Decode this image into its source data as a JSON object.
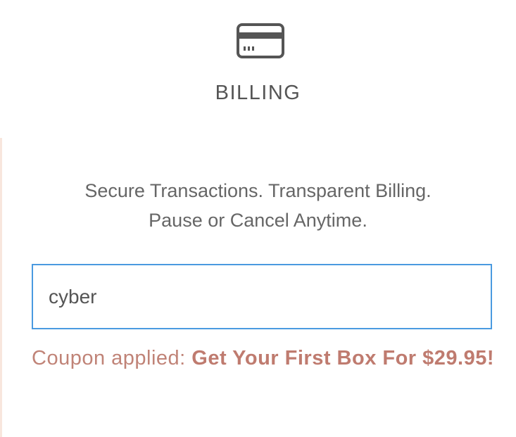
{
  "header": {
    "icon": "credit-card-icon",
    "title": "BILLING"
  },
  "tagline": {
    "line1": "Secure Transactions. Transparent Billing.",
    "line2": "Pause or Cancel Anytime."
  },
  "coupon": {
    "value": "cyber",
    "message_prefix": "Coupon applied: ",
    "offer_text": "Get Your First Box For $29.95!"
  },
  "colors": {
    "input_border": "#4a9ae0",
    "coupon_text": "#c08377",
    "title_text": "#555555"
  }
}
